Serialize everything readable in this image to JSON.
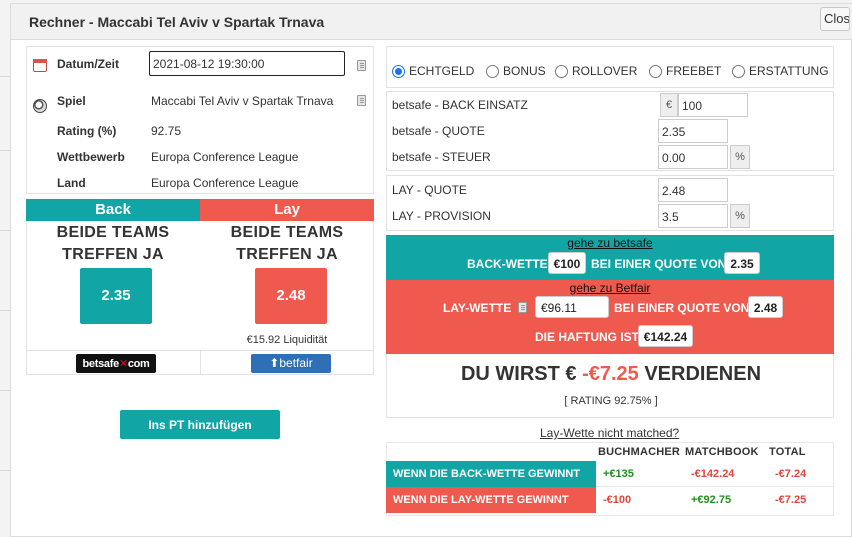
{
  "modal": {
    "title": "Rechner - Maccabi Tel Aviv v Spartak Trnava",
    "close_label": "Close"
  },
  "event_info": {
    "datetime_label": "Datum/Zeit",
    "datetime_value": "2021-08-12 19:30:00",
    "game_label": "Spiel",
    "game_value": "Maccabi Tel Aviv v Spartak Trnava",
    "rating_label": "Rating (%)",
    "rating_value": "92.75",
    "competition_label": "Wettbewerb",
    "competition_value": "Europa Conference League",
    "country_label": "Land",
    "country_value": "Europa Conference League"
  },
  "back": {
    "heading": "Back",
    "market_line1": "BEIDE TEAMS",
    "market_line2": "TREFFEN JA",
    "odds": "2.35",
    "bookmaker_logo_a": "betsafe",
    "bookmaker_logo_b": "com",
    "color": "#12a5a5"
  },
  "lay": {
    "heading": "Lay",
    "market_line1": "BEIDE TEAMS",
    "market_line2": "TREFFEN JA",
    "odds": "2.48",
    "liquidity": "€15.92 Liquidität",
    "exchange_logo": "betfair",
    "color": "#f0594d"
  },
  "add_button": "Ins PT hinzufügen",
  "bet_types": {
    "options": [
      "ECHTGELD",
      "BONUS",
      "ROLLOVER",
      "FREEBET",
      "ERSTATTUNG"
    ],
    "selected": "ECHTGELD"
  },
  "calc": {
    "back_stake_label": "betsafe - BACK EINSATZ",
    "currency": "€",
    "back_stake": "100",
    "back_odds_label": "betsafe - QUOTE",
    "back_odds": "2.35",
    "tax_label": "betsafe - STEUER",
    "tax": "0.00",
    "percent": "%",
    "lay_odds_label": "LAY - QUOTE",
    "lay_odds": "2.48",
    "commission_label": "LAY - PROVISION",
    "commission": "3.5"
  },
  "instructions": {
    "back_link": "gehe zu betsafe",
    "back_bet_label": "BACK-WETTE",
    "back_stake": "€100",
    "at_odds_label": "BEI EINER QUOTE VON",
    "back_odds": "2.35",
    "lay_link": "gehe zu Betfair",
    "lay_bet_label": "LAY-WETTE",
    "lay_stake": "€96.11",
    "lay_odds": "2.48",
    "liability_label": "DIE HAFTUNG IST",
    "liability": "€142.24"
  },
  "result": {
    "prefix": "DU WIRST €",
    "amount": "-€7.25",
    "suffix": "VERDIENEN",
    "rating_line": "[ RATING 92.75% ]",
    "not_matched_link": "Lay-Wette nicht matched?"
  },
  "outcome_table": {
    "headers": [
      "BUCHMACHER",
      "MATCHBOOK",
      "TOTAL"
    ],
    "rows": [
      {
        "label": "WENN DIE BACK-WETTE GEWINNT",
        "bookmaker": "+€135",
        "exchange": "-€142.24",
        "total": "-€7.24"
      },
      {
        "label": "WENN DIE LAY-WETTE GEWINNT",
        "bookmaker": "-€100",
        "exchange": "+€92.75",
        "total": "-€7.25"
      }
    ]
  }
}
